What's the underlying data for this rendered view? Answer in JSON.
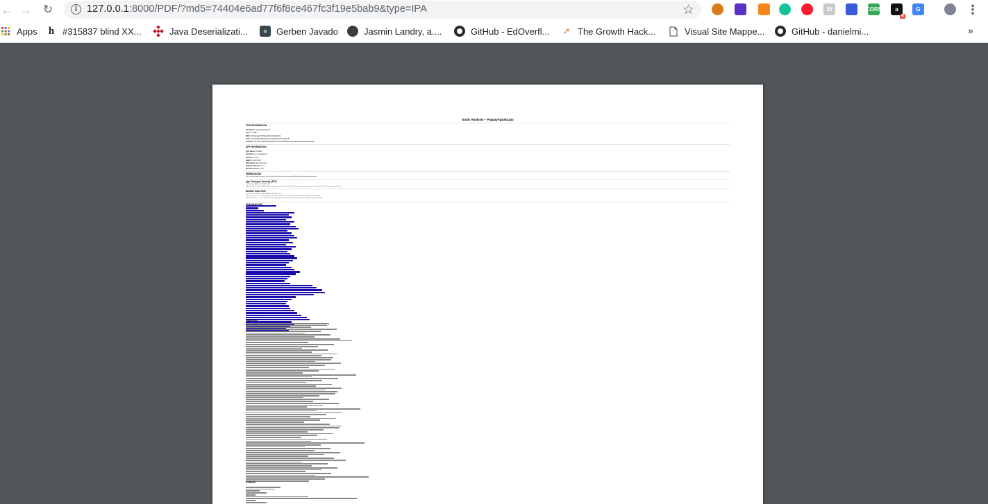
{
  "browser": {
    "url_prefix": "127.0.0.1",
    "url_rest": ":8000/PDF/?md5=74404e6ad77f6f8ce467fc3f19e5bab9&type=IPA",
    "back_icon": "arrow-left-icon",
    "forward_icon": "arrow-right-icon",
    "reload_icon": "reload-icon",
    "star_icon": "star-icon",
    "extensions": [
      {
        "name": "ext-orange-circle-icon",
        "color": "#d77b1d",
        "label": ""
      },
      {
        "name": "ext-purple-diamond-icon",
        "color": "#5b2fc4",
        "label": ""
      },
      {
        "name": "ext-metamask-fox-icon",
        "color": "#f6851b",
        "label": ""
      },
      {
        "name": "ext-grammarly-icon",
        "color": "#15c39a",
        "label": ""
      },
      {
        "name": "ext-opera-red-icon",
        "color": "#ff1b2d",
        "label": ""
      },
      {
        "name": "ext-id-icon",
        "color": "#c8c8c8",
        "label": "iD"
      },
      {
        "name": "ext-pipette-icon",
        "color": "#3b5bdb",
        "label": ""
      },
      {
        "name": "ext-cors-icon",
        "color": "#33a853",
        "label": "CORS"
      },
      {
        "name": "ext-amazon-icon",
        "color": "#111111",
        "label": "a",
        "badge": "6"
      },
      {
        "name": "ext-google-translate-icon",
        "color": "#4285f4",
        "label": "G"
      },
      {
        "name": "profile-avatar",
        "color": "#7e8591",
        "label": ""
      }
    ]
  },
  "bookmarks": [
    {
      "label": "Apps",
      "icon": "apps-grid-icon"
    },
    {
      "label": "#315837 blind XX...",
      "icon": "hackerone-icon"
    },
    {
      "label": "Java Deserializati...",
      "icon": "red-pattern-icon"
    },
    {
      "label": "Gerben Javado",
      "icon": "dark-square-icon"
    },
    {
      "label": "Jasmin Landry, a....",
      "icon": "avatar-icon"
    },
    {
      "label": "GitHub - EdOverfl...",
      "icon": "github-icon"
    },
    {
      "label": "The Growth Hack...",
      "icon": "rocket-icon"
    },
    {
      "label": "Visual Site Mappe...",
      "icon": "file-icon"
    },
    {
      "label": "GitHub - danielmi...",
      "icon": "github-icon"
    }
  ],
  "bookmarks_overflow": "»",
  "pdf": {
    "title": "Static Analysis – PaypayAppSig.ipa",
    "sections": {
      "file_info": "FILE INFORMATION",
      "app_info": "APP INFORMATION",
      "permissions": "PERMISSIONS",
      "ats": "App Transport Security (ATS)",
      "binary": "BINARY ANALYSIS",
      "files": "FILE ANALYSIS",
      "libraries": "LIBRARIES",
      "strings": "STRINGS"
    },
    "file_info_keys": [
      "File Name:",
      "Size:",
      "MD5:",
      "SHA1:",
      "SHA256:"
    ],
    "app_info_keys": [
      "App Name:",
      "Identifier:",
      "Version:",
      "Build:",
      "SDK Name:",
      "Platform Version:",
      "Min OS Version:"
    ]
  },
  "colors": {
    "chrome_bg": "#ffffff",
    "omnibox_bg": "#f1f3f4",
    "viewer_bg": "#525659",
    "link": "#1a0dab"
  }
}
